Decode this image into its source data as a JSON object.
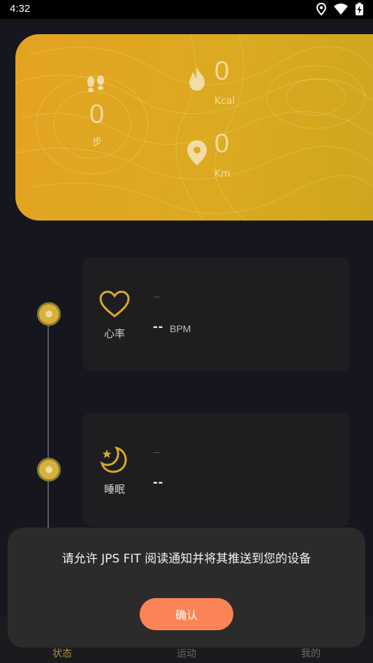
{
  "status_bar": {
    "time": "4:32",
    "icons": [
      "location-icon",
      "wifi-icon",
      "battery-charging-icon"
    ]
  },
  "summary": {
    "steps_value": "0",
    "steps_label": "步",
    "kcal_value": "0",
    "kcal_label": "Kcal",
    "km_value": "0",
    "km_label": "Km",
    "colors": {
      "card_start": "#e3a321",
      "card_end": "#cda61d"
    }
  },
  "metrics": [
    {
      "name": "心率",
      "sub": "--",
      "value": "--",
      "unit": "BPM",
      "icon": "heart-icon"
    },
    {
      "name": "睡眠",
      "sub": "--",
      "value": "--",
      "icon": "moon-icon"
    }
  ],
  "permission_dialog": {
    "message": "请允许 JPS FIT 阅读通知并将其推送到您的设备",
    "confirm_label": "确认",
    "confirm_color": "#fb8456"
  },
  "bottom_nav": {
    "items": [
      {
        "label": "状态",
        "active": true
      },
      {
        "label": "运动",
        "active": false
      },
      {
        "label": "我的",
        "active": false
      }
    ],
    "active_color": "#b08e2a"
  }
}
